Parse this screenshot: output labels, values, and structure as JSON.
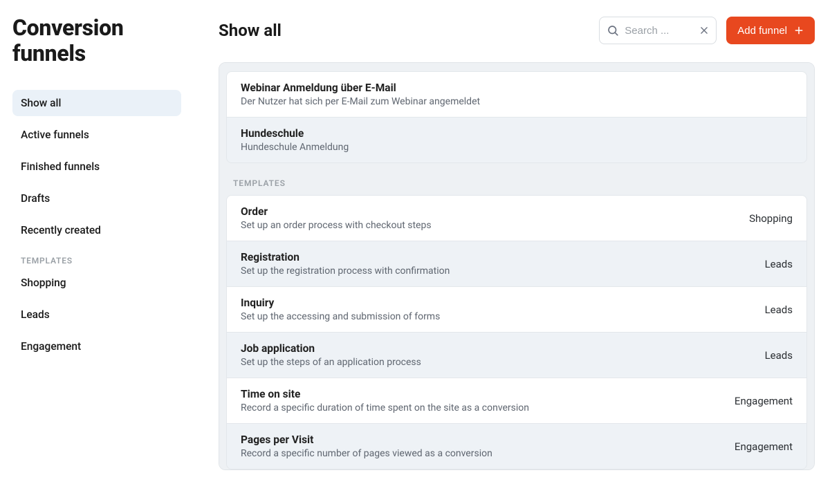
{
  "sidebar": {
    "title": "Conversion funnels",
    "primary": [
      {
        "label": "Show all",
        "selected": true
      },
      {
        "label": "Active funnels",
        "selected": false
      },
      {
        "label": "Finished funnels",
        "selected": false
      },
      {
        "label": "Drafts",
        "selected": false
      },
      {
        "label": "Recently created",
        "selected": false
      }
    ],
    "templates_heading": "TEMPLATES",
    "templates": [
      {
        "label": "Shopping"
      },
      {
        "label": "Leads"
      },
      {
        "label": "Engagement"
      }
    ]
  },
  "header": {
    "title": "Show all",
    "search_placeholder": "Search ...",
    "search_value": "",
    "add_label": "Add funnel"
  },
  "funnels": [
    {
      "title": "Webinar Anmeldung über E-Mail",
      "subtitle": "Der Nutzer hat sich per E-Mail zum Webinar angemeldet"
    },
    {
      "title": "Hundeschule",
      "subtitle": "Hundeschule Anmeldung"
    }
  ],
  "templates_section_label": "TEMPLATES",
  "template_rows": [
    {
      "title": "Order",
      "subtitle": "Set up an order process with checkout steps",
      "category": "Shopping"
    },
    {
      "title": "Registration",
      "subtitle": "Set up the registration process with confirmation",
      "category": "Leads"
    },
    {
      "title": "Inquiry",
      "subtitle": "Set up the accessing and submission of forms",
      "category": "Leads"
    },
    {
      "title": "Job application",
      "subtitle": "Set up the steps of an application process",
      "category": "Leads"
    },
    {
      "title": "Time on site",
      "subtitle": "Record a specific duration of time spent on the site as a conversion",
      "category": "Engagement"
    },
    {
      "title": "Pages per Visit",
      "subtitle": "Record a specific number of pages viewed as a conversion",
      "category": "Engagement"
    }
  ]
}
